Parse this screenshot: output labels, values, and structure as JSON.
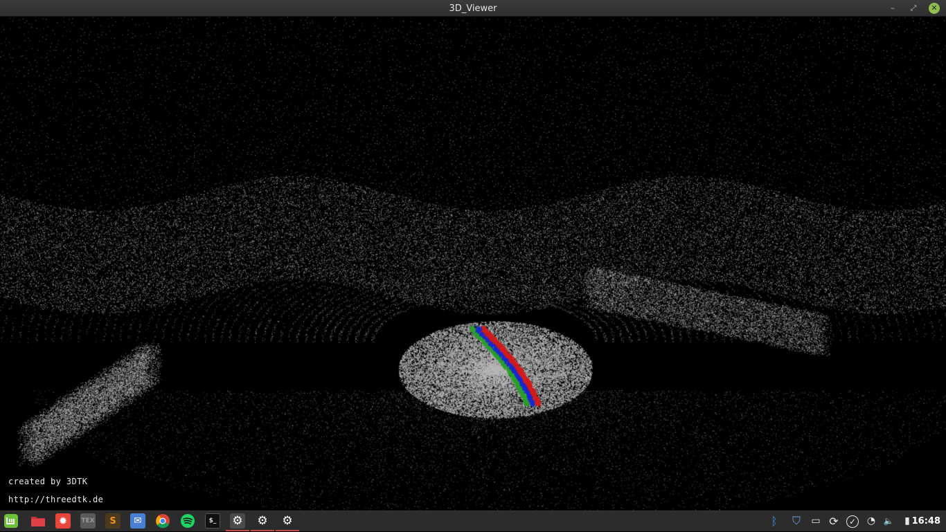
{
  "window": {
    "title": "3D_Viewer",
    "controls": {
      "minimize": "–",
      "maximize": "⤢",
      "close": "✕"
    }
  },
  "viewer": {
    "overlay_line1": "created by 3DTK",
    "overlay_line2": "http://threedtk.de",
    "background": "#000000",
    "point_color": "#bdbdbd",
    "trajectory_colors": [
      "#2aa02a",
      "#1a28d0",
      "#d21c1c"
    ]
  },
  "taskbar": {
    "launchers": [
      {
        "name": "mint-menu-icon",
        "color": "#6fbf3a",
        "glyph": ""
      },
      {
        "name": "files-folder-icon",
        "color": "#c8323a",
        "glyph": ""
      },
      {
        "name": "red-app-icon",
        "color": "#e8453c",
        "glyph": "✹"
      },
      {
        "name": "tex-editor-icon",
        "color": "#5a5a5a",
        "glyph": "TEX"
      },
      {
        "name": "sublime-text-icon",
        "color": "#f0951a",
        "glyph": "S"
      },
      {
        "name": "mail-icon",
        "color": "#4b7fd6",
        "glyph": "✉"
      },
      {
        "name": "chrome-icon",
        "color": "#e6b11d",
        "glyph": ""
      },
      {
        "name": "spotify-icon",
        "color": "#1ed760",
        "glyph": ""
      },
      {
        "name": "terminal-icon",
        "color": "#111111",
        "glyph": "$_"
      },
      {
        "name": "window-3d-viewer-gear-icon",
        "color": "#ffffff",
        "glyph": "⚙"
      },
      {
        "name": "window-gear-icon-2",
        "color": "#ffffff",
        "glyph": "⚙"
      },
      {
        "name": "window-gear-icon-3",
        "color": "#ffffff",
        "glyph": "⚙"
      }
    ],
    "tray": [
      {
        "name": "bluetooth-icon",
        "glyph": "ᛒ"
      },
      {
        "name": "shield-update-icon",
        "glyph": "⛉"
      },
      {
        "name": "display-icon",
        "glyph": "▭"
      },
      {
        "name": "sync-icon",
        "glyph": "⟳"
      },
      {
        "name": "check-icon",
        "glyph": "✓"
      },
      {
        "name": "wifi-icon",
        "glyph": "◔"
      },
      {
        "name": "volume-muted-icon",
        "glyph": "🔈"
      },
      {
        "name": "battery-icon",
        "glyph": "▮"
      }
    ],
    "clock": "16:48"
  }
}
